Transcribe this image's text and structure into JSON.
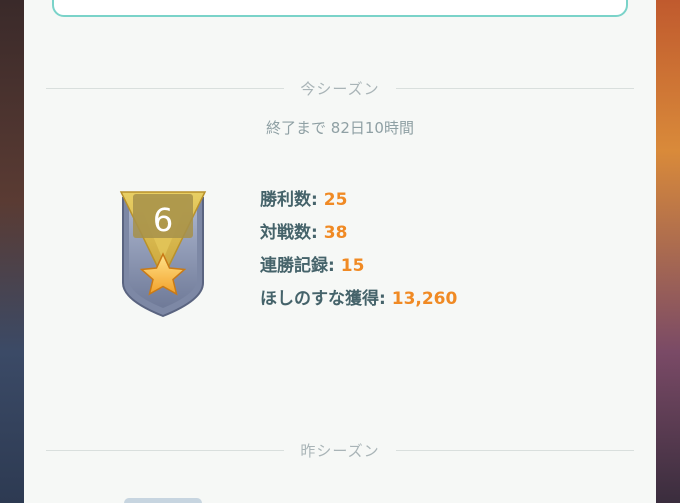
{
  "this_season": {
    "header": "今シーズン",
    "countdown": "終了まで 82日10時間",
    "rank": "6",
    "stats": [
      {
        "label": "勝利数:",
        "value": "25"
      },
      {
        "label": "対戦数:",
        "value": "38"
      },
      {
        "label": "連勝記録:",
        "value": "15"
      },
      {
        "label": "ほしのすな獲得:",
        "value": "13,260"
      }
    ]
  },
  "last_season": {
    "header": "昨シーズン"
  },
  "colors": {
    "accent_value": "#f08a24",
    "label_text": "#45636a",
    "header_text": "#a9b4b7",
    "top_box_border": "#7ad3c9",
    "badge_gold": "#d9b74a",
    "badge_silver": "#8e99b5"
  },
  "icons": {
    "badge": "rank-shield-icon",
    "star": "star-icon"
  }
}
